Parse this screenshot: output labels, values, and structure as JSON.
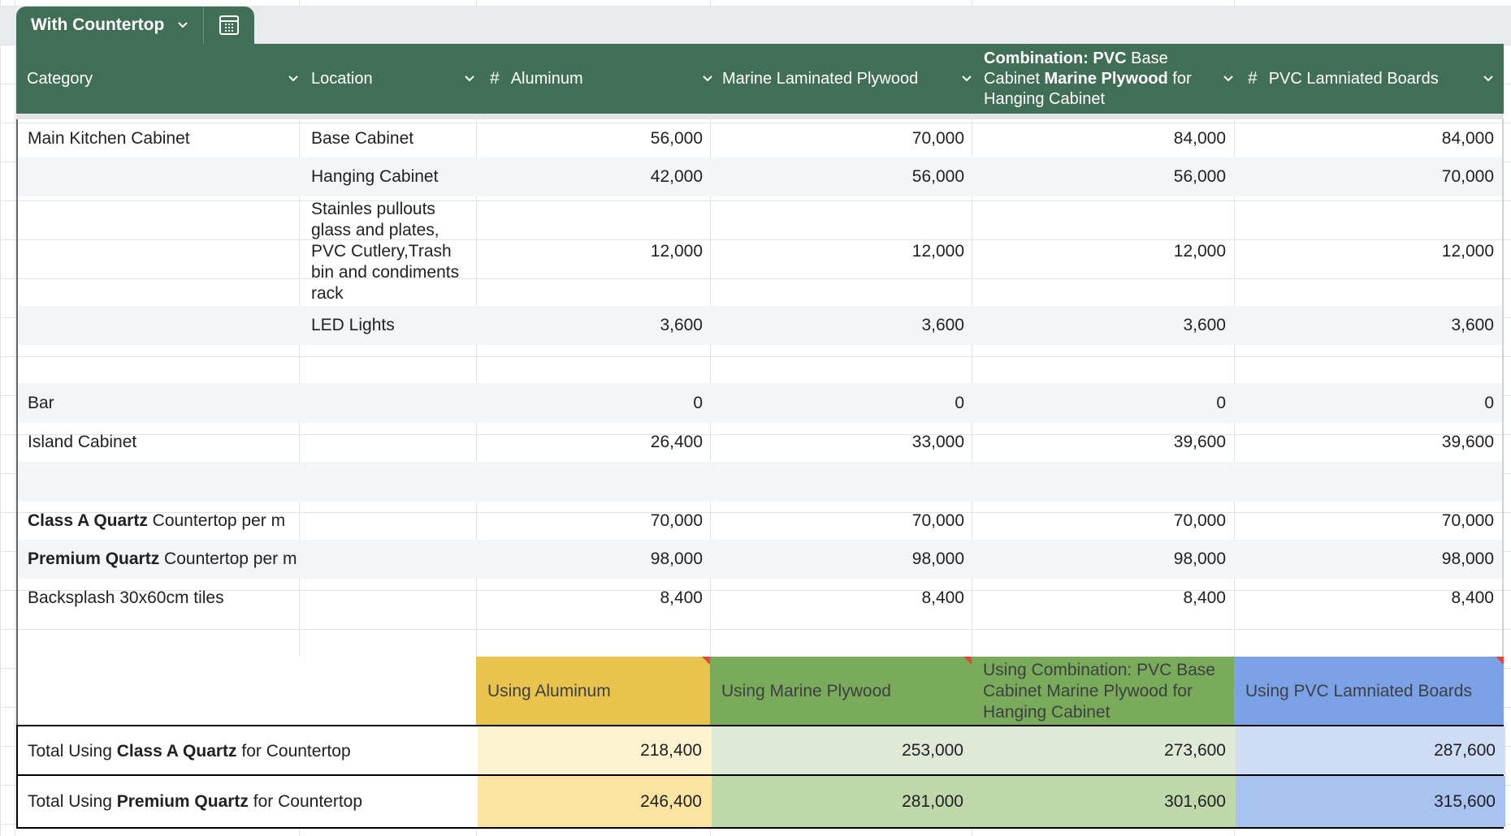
{
  "sheet_tab": {
    "name": "With Countertop",
    "calc_icon": "calculator-table-icon"
  },
  "columns": [
    {
      "label": "Category",
      "has_hash": false
    },
    {
      "label": "Location",
      "has_hash": false
    },
    {
      "label": "Aluminum",
      "has_hash": true
    },
    {
      "label": "Marine Laminated Plywood",
      "has_hash": false
    },
    {
      "label_parts": [
        "Combination: PVC",
        " Base Cabinet ",
        "Marine Plywood",
        " for Hanging Cabinet"
      ],
      "has_hash": false
    },
    {
      "label": "PVC Lamniated Boards",
      "has_hash": true
    }
  ],
  "rows": [
    {
      "category": "Main Kitchen Cabinet",
      "location": "Base Cabinet",
      "values": [
        "56,000",
        "70,000",
        "84,000",
        "84,000"
      ]
    },
    {
      "category": "",
      "location": "Hanging Cabinet",
      "values": [
        "42,000",
        "56,000",
        "56,000",
        "70,000"
      ]
    },
    {
      "category": "",
      "location": "Stainles pullouts glass and plates, PVC Cutlery,Trash bin and condiments rack",
      "values": [
        "12,000",
        "12,000",
        "12,000",
        "12,000"
      ]
    },
    {
      "category": "",
      "location": "LED Lights",
      "values": [
        "3,600",
        "3,600",
        "3,600",
        "3,600"
      ]
    },
    {
      "category": "",
      "location": "",
      "values": [
        "",
        "",
        "",
        ""
      ]
    },
    {
      "category": "Bar",
      "location": "",
      "values": [
        "0",
        "0",
        "0",
        "0"
      ]
    },
    {
      "category": "Island Cabinet",
      "location": "",
      "values": [
        "26,400",
        "33,000",
        "39,600",
        "39,600"
      ]
    },
    {
      "category": "",
      "location": "",
      "values": [
        "",
        "",
        "",
        ""
      ]
    },
    {
      "category_bold": "Class A Quartz",
      "category_rest": " Countertop per m",
      "location": "",
      "values": [
        "70,000",
        "70,000",
        "70,000",
        "70,000"
      ]
    },
    {
      "category_bold": "Premium Quartz",
      "category_rest": " Countertop per m",
      "location": "",
      "values": [
        "98,000",
        "98,000",
        "98,000",
        "98,000"
      ]
    },
    {
      "category": "Backsplash 30x60cm tiles",
      "location": "",
      "values": [
        "8,400",
        "8,400",
        "8,400",
        "8,400"
      ]
    }
  ],
  "summary": {
    "headers": [
      "Using Aluminum",
      "Using Marine Plywood",
      "Using Combination: PVC Base Cabinet Marine Plywood for Hanging Cabinet",
      "Using PVC Lamniated Boards"
    ],
    "header_colors": [
      "#e8c34d",
      "#7aab5a",
      "#7aab5a",
      "#7ba2e6"
    ],
    "totals": [
      {
        "pre": "Total Using ",
        "bold": "Class A Quartz",
        "post": " for Countertop",
        "values": [
          "218,400",
          "253,000",
          "273,600",
          "287,600"
        ]
      },
      {
        "pre": "Total Using ",
        "bold": "Premium Quartz",
        "post": " for Countertop",
        "values": [
          "246,400",
          "281,000",
          "301,600",
          "315,600"
        ]
      }
    ],
    "row_colors": [
      [
        "#fdf3d0",
        "#dfe9d6",
        "#dfe9d6",
        "#cfdcf5"
      ],
      [
        "#fbe3a0",
        "#bed8a9",
        "#bed8a9",
        "#a9c3f0"
      ]
    ]
  }
}
